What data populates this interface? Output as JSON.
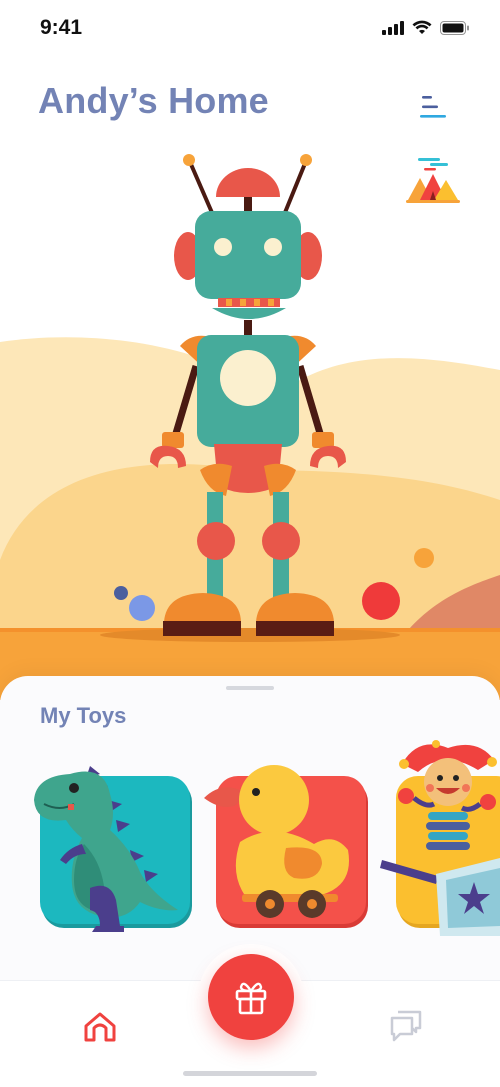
{
  "status_bar": {
    "time": "9:41"
  },
  "header": {
    "title": "Andy’s Home"
  },
  "toys_section": {
    "title": "My Toys",
    "toys": [
      {
        "name": "dinosaur",
        "card_color": "#1cb8bf"
      },
      {
        "name": "duck",
        "card_color": "#f4514a"
      },
      {
        "name": "jack-in-the-box",
        "card_color": "#fbbf2f"
      }
    ]
  },
  "tab_bar": {
    "items": [
      {
        "icon": "home-icon",
        "active": true
      },
      {
        "icon": "gift-icon",
        "primary": true
      },
      {
        "icon": "chat-icon",
        "active": false
      }
    ]
  },
  "colors": {
    "title": "#7383b5",
    "accent_red": "#f0423f",
    "robot_teal": "#46ab9b",
    "ground_orange": "#f7a33a"
  }
}
